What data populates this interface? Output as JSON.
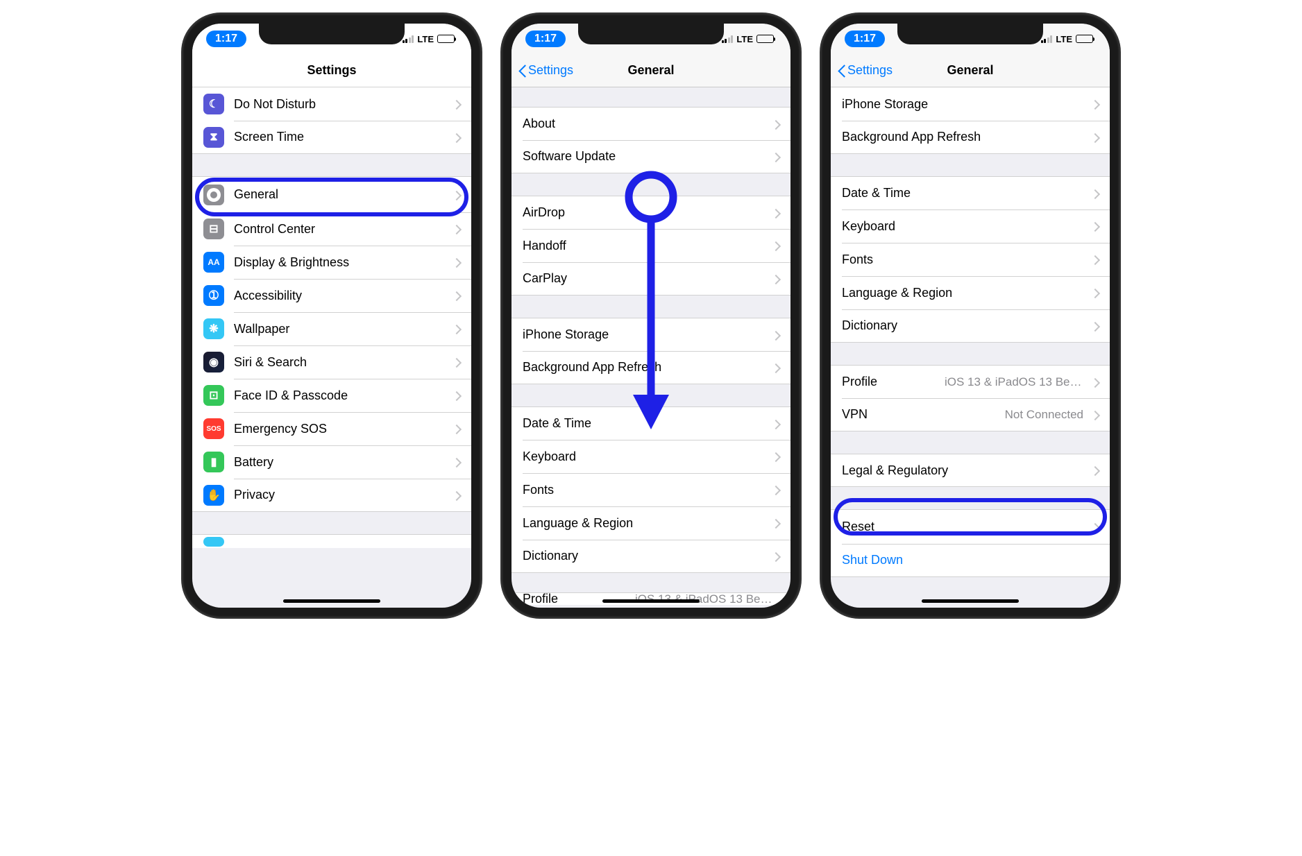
{
  "status": {
    "time": "1:17",
    "carrier": "LTE"
  },
  "screen1": {
    "nav_title": "Settings",
    "group1": [
      {
        "id": "dnd",
        "label": "Do Not Disturb",
        "icon": "moon-icon",
        "color": "ic-purple",
        "glyph": "☾"
      },
      {
        "id": "screentime",
        "label": "Screen Time",
        "icon": "hourglass-icon",
        "color": "ic-purple",
        "glyph": "⧗"
      }
    ],
    "group2": [
      {
        "id": "general",
        "label": "General",
        "icon": "gear-icon",
        "color": "ic-gray",
        "glyph": "",
        "highlighted": true
      },
      {
        "id": "control",
        "label": "Control Center",
        "icon": "switches-icon",
        "color": "ic-graylight",
        "glyph": "⊟"
      },
      {
        "id": "display",
        "label": "Display & Brightness",
        "icon": "text-size-icon",
        "color": "ic-blue",
        "glyph": "AA"
      },
      {
        "id": "accessibility",
        "label": "Accessibility",
        "icon": "accessibility-icon",
        "color": "ic-blue",
        "glyph": "➀"
      },
      {
        "id": "wallpaper",
        "label": "Wallpaper",
        "icon": "flower-icon",
        "color": "ic-cyan",
        "glyph": "❋"
      },
      {
        "id": "siri",
        "label": "Siri & Search",
        "icon": "siri-icon",
        "color": "ic-siri",
        "glyph": "◉"
      },
      {
        "id": "faceid",
        "label": "Face ID & Passcode",
        "icon": "faceid-icon",
        "color": "ic-green",
        "glyph": "⊡"
      },
      {
        "id": "sos",
        "label": "Emergency SOS",
        "icon": "sos-icon",
        "color": "ic-red",
        "glyph": "SOS"
      },
      {
        "id": "battery",
        "label": "Battery",
        "icon": "battery-icon",
        "color": "ic-green",
        "glyph": "▮"
      },
      {
        "id": "privacy",
        "label": "Privacy",
        "icon": "hand-icon",
        "color": "ic-bluelight",
        "glyph": "✋"
      }
    ]
  },
  "screen2": {
    "nav_back": "Settings",
    "nav_title": "General",
    "group1": [
      "About",
      "Software Update"
    ],
    "group2": [
      "AirDrop",
      "Handoff",
      "CarPlay"
    ],
    "group3": [
      "iPhone Storage",
      "Background App Refresh"
    ],
    "group4": [
      "Date & Time",
      "Keyboard",
      "Fonts",
      "Language & Region",
      "Dictionary"
    ],
    "peek_label": "Profile",
    "peek_detail": "iOS 13 & iPadOS 13 Beta Softwar..."
  },
  "screen3": {
    "nav_back": "Settings",
    "nav_title": "General",
    "group0": [
      "iPhone Storage",
      "Background App Refresh"
    ],
    "group1": [
      "Date & Time",
      "Keyboard",
      "Fonts",
      "Language & Region",
      "Dictionary"
    ],
    "group2": [
      {
        "label": "Profile",
        "detail": "iOS 13 & iPadOS 13 Beta Softwar..."
      },
      {
        "label": "VPN",
        "detail": "Not Connected"
      }
    ],
    "group3": [
      "Legal & Regulatory"
    ],
    "group4": [
      {
        "label": "Reset",
        "highlighted": true
      },
      {
        "label": "Shut Down",
        "blue": true,
        "no_chev": true
      }
    ]
  }
}
